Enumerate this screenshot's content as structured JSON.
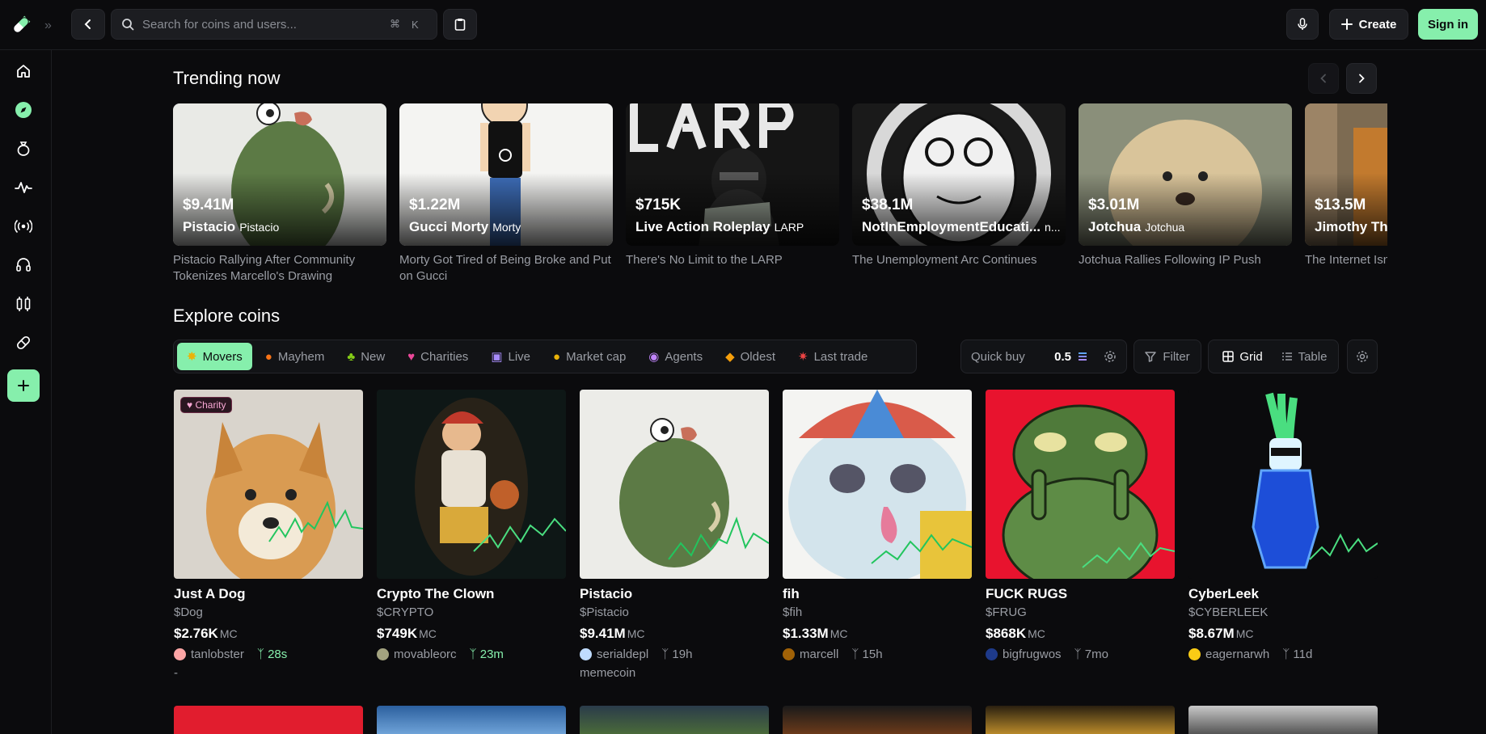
{
  "search": {
    "placeholder": "Search for coins and users...",
    "shortcut_cmd": "⌘",
    "shortcut_key": "K"
  },
  "header": {
    "create_label": "Create",
    "signin_label": "Sign in"
  },
  "sidebar": {
    "items": [
      "home",
      "explore",
      "bag",
      "activity",
      "broadcast",
      "support",
      "compare",
      "pill",
      "add"
    ]
  },
  "trending": {
    "title": "Trending now",
    "cards": [
      {
        "mc": "$9.41M",
        "name": "Pistacio",
        "ticker": "Pistacio",
        "desc": "Pistacio Rallying After Community Tokenizes Marcello's Drawing"
      },
      {
        "mc": "$1.22M",
        "name": "Gucci Morty",
        "ticker": "Morty",
        "desc": "Morty Got Tired of Being Broke and Put on Gucci"
      },
      {
        "mc": "$715K",
        "name": "Live Action Roleplay",
        "ticker": "LARP",
        "desc": "There's No Limit to the LARP"
      },
      {
        "mc": "$38.1M",
        "name": "NotInEmploymentEducati...",
        "ticker": "n...",
        "desc": "The Unemployment Arc Continues"
      },
      {
        "mc": "$3.01M",
        "name": "Jotchua",
        "ticker": "Jotchua",
        "desc": "Jotchua Rallies Following IP Push"
      },
      {
        "mc": "$13.5M",
        "name": "Jimothy The",
        "ticker": "",
        "desc": "The Internet Isn Yet"
      }
    ]
  },
  "explore": {
    "title": "Explore coins",
    "chips": [
      "Movers",
      "Mayhem",
      "New",
      "Charities",
      "Live",
      "Market cap",
      "Agents",
      "Oldest",
      "Last trade"
    ],
    "quick_buy_label": "Quick buy",
    "quick_buy_value": "0.5",
    "filter_label": "Filter",
    "view_grid": "Grid",
    "view_table": "Table"
  },
  "coins": [
    {
      "badge": "Charity",
      "name": "Just A Dog",
      "ticker": "$Dog",
      "mc": "$2.76K",
      "mc_unit": "MC",
      "user": "tanlobster",
      "age": "28s",
      "extra": "-"
    },
    {
      "badge": "",
      "name": "Crypto The Clown",
      "ticker": "$CRYPTO",
      "mc": "$749K",
      "mc_unit": "MC",
      "user": "movableorc",
      "age": "23m",
      "extra": ""
    },
    {
      "badge": "",
      "name": "Pistacio",
      "ticker": "$Pistacio",
      "mc": "$9.41M",
      "mc_unit": "MC",
      "user": "serialdepl",
      "age": "19h",
      "extra": "memecoin"
    },
    {
      "badge": "",
      "name": "fih",
      "ticker": "$fih",
      "mc": "$1.33M",
      "mc_unit": "MC",
      "user": "marcell",
      "age": "15h",
      "extra": ""
    },
    {
      "badge": "",
      "name": "FUCK RUGS",
      "ticker": "$FRUG",
      "mc": "$868K",
      "mc_unit": "MC",
      "user": "bigfrugwos",
      "age": "7mo",
      "extra": ""
    },
    {
      "badge": "",
      "name": "CyberLeek",
      "ticker": "$CYBERLEEK",
      "mc": "$8.67M",
      "mc_unit": "MC",
      "user": "eagernarwh",
      "age": "11d",
      "extra": ""
    }
  ],
  "colors": {
    "accent": "#86efac",
    "background": "#0b0b0d",
    "muted": "#9a9da4"
  }
}
